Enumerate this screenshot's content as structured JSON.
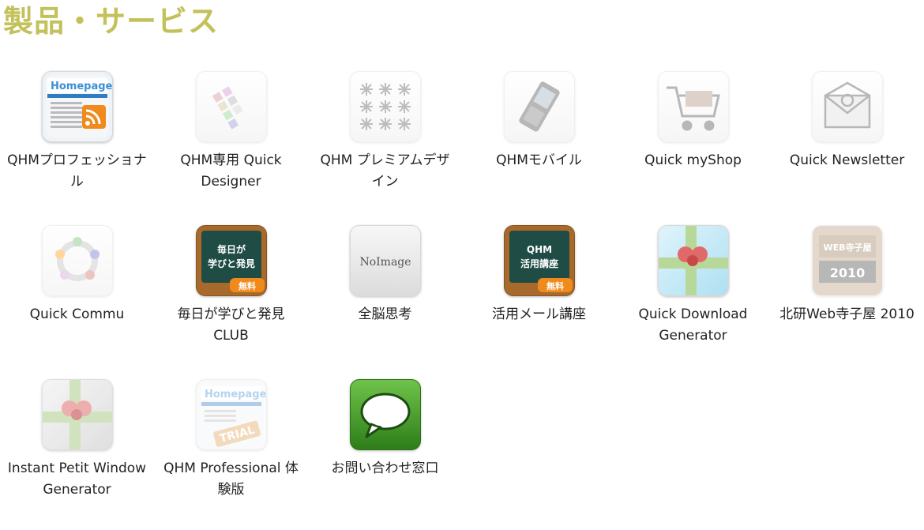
{
  "section": {
    "title": "製品・サービス"
  },
  "products": [
    {
      "label": "QHMプロフェッショナル",
      "icon": "homepage-rss-icon"
    },
    {
      "label": "QHM専用 Quick Designer",
      "icon": "color-swatch-icon"
    },
    {
      "label": "QHM プレミアムデザイン",
      "icon": "snowflake-pattern-icon"
    },
    {
      "label": "QHMモバイル",
      "icon": "mobile-phone-icon"
    },
    {
      "label": "Quick myShop",
      "icon": "shopping-cart-icon"
    },
    {
      "label": "Quick Newsletter",
      "icon": "envelope-icon"
    },
    {
      "label": "Quick Commu",
      "icon": "people-circle-icon"
    },
    {
      "label": "毎日が学びと発見 CLUB",
      "icon": "chalkboard-icon",
      "icon_text": [
        "毎日が",
        "学びと発見"
      ],
      "badge": "無料"
    },
    {
      "label": "全脳思考",
      "icon": "no-image-icon",
      "icon_text": [
        "NoImage"
      ]
    },
    {
      "label": "活用メール講座",
      "icon": "chalkboard-icon",
      "icon_text": [
        "QHM",
        "活用講座"
      ],
      "badge": "無料"
    },
    {
      "label": "Quick Download Generator",
      "icon": "gift-ribbon-icon"
    },
    {
      "label": "北研Web寺子屋 2010",
      "icon": "terakoya-icon",
      "icon_text": [
        "WEB寺子屋",
        "2010"
      ]
    },
    {
      "label": "Instant Petit Window Generator",
      "icon": "gift-ribbon-icon"
    },
    {
      "label": "QHM Professional 体験版",
      "icon": "homepage-trial-icon",
      "icon_text": [
        "Homepage",
        "TRIAL"
      ]
    },
    {
      "label": "お問い合わせ窓口",
      "icon": "speech-bubble-icon"
    }
  ]
}
